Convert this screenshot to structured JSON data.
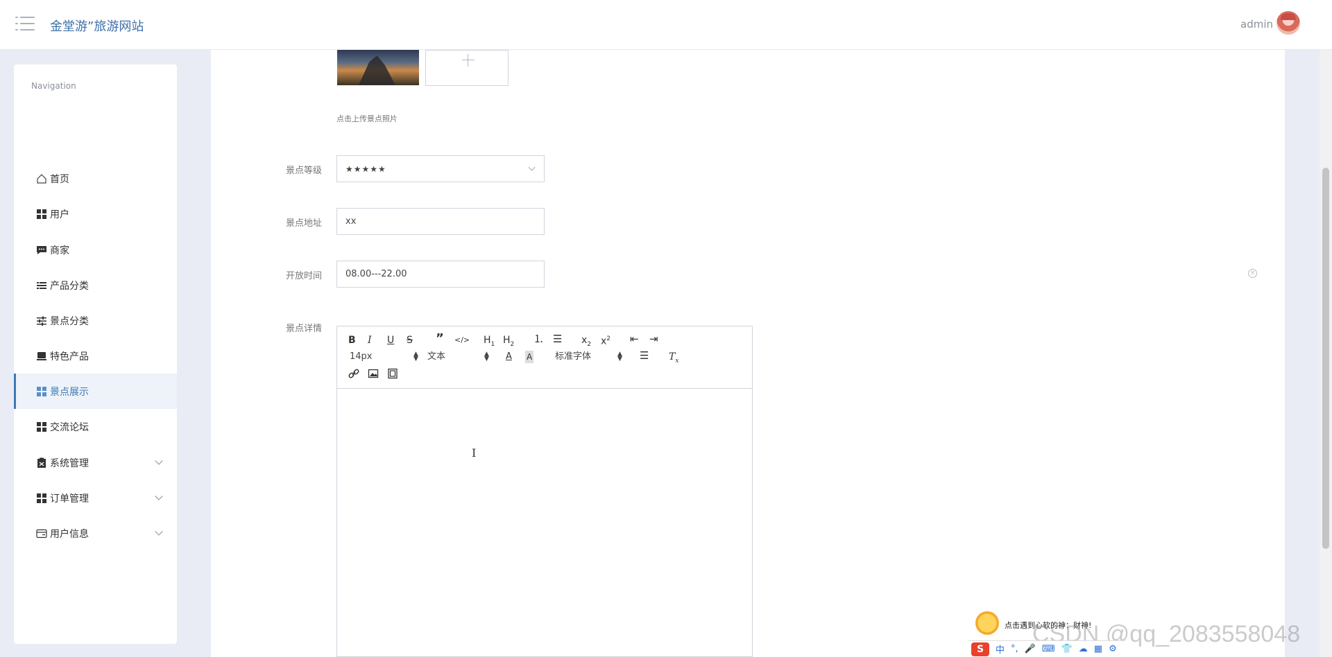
{
  "header": {
    "app_title": "金堂游”旅游网站",
    "user_name": "admin"
  },
  "sidebar": {
    "title": "Navigation",
    "items": [
      {
        "label": "首页",
        "icon": "home-icon"
      },
      {
        "label": "用户",
        "icon": "grid-icon"
      },
      {
        "label": "商家",
        "icon": "chat-icon"
      },
      {
        "label": "产品分类",
        "icon": "list-icon"
      },
      {
        "label": "景点分类",
        "icon": "sliders-icon"
      },
      {
        "label": "特色产品",
        "icon": "shop-icon"
      },
      {
        "label": "景点展示",
        "icon": "grid-icon",
        "active": true
      },
      {
        "label": "交流论坛",
        "icon": "grid-icon"
      },
      {
        "label": "系统管理",
        "icon": "clipboard-icon",
        "expandable": true
      },
      {
        "label": "订单管理",
        "icon": "grid-icon",
        "expandable": true
      },
      {
        "label": "用户信息",
        "icon": "card-icon",
        "expandable": true
      }
    ]
  },
  "form": {
    "upload_hint": "点击上传景点照片",
    "level_label": "景点等级",
    "level_value": "★★★★★",
    "address_label": "景点地址",
    "address_value": "xx",
    "open_time_label": "开放时间",
    "open_time_value": "08.00---22.00",
    "detail_label": "景点详情"
  },
  "editor": {
    "font_size": "14px",
    "block_format": "文本",
    "font_family": "标准字体"
  },
  "ime": {
    "bubble_text": "点击遇到心软的神：财神!",
    "bar_items": [
      "S",
      "中",
      "°,",
      "🎤",
      "⌨",
      "👕",
      "☁",
      "▦",
      "⚙"
    ]
  },
  "watermark": "CSDN @qq_2083558048"
}
